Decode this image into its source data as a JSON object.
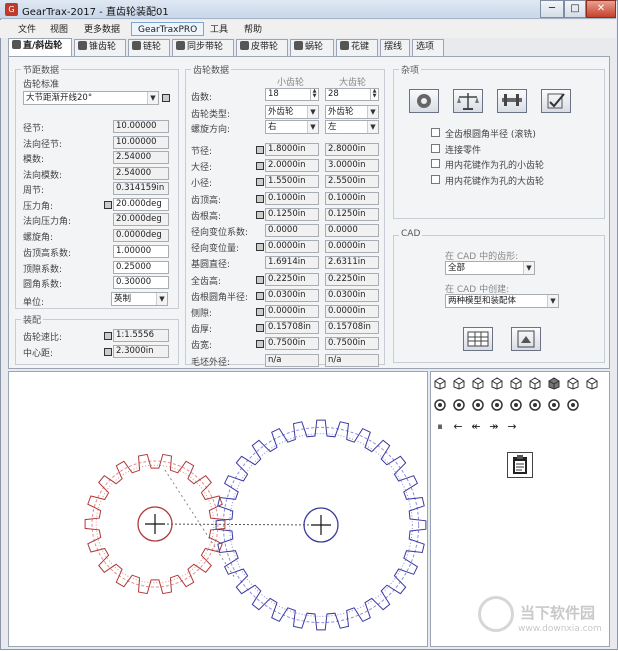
{
  "window": {
    "title": "GearTrax-2017 - 直齿轮装配01",
    "app_icon": "G",
    "min": "─",
    "max": "□",
    "close": "✕"
  },
  "menu": [
    "文件",
    "视图",
    "更多数据",
    "GearTraxPRO",
    "工具",
    "帮助"
  ],
  "tabs": [
    "直/斜齿轮",
    "锥齿轮",
    "链轮",
    "同步带轮",
    "皮带轮",
    "蜗轮",
    "花键",
    "摆线",
    "选项"
  ],
  "pitch": {
    "title": "节距数据",
    "standard_label": "齿轮标准",
    "standard_value": "大节距渐开线20°",
    "rows": [
      {
        "label": "径节:",
        "value": "10.00000"
      },
      {
        "label": "法向径节:",
        "value": "10.00000"
      },
      {
        "label": "模数:",
        "value": "2.54000"
      },
      {
        "label": "法向模数:",
        "value": "2.54000"
      },
      {
        "label": "周节:",
        "value": "0.314159in"
      },
      {
        "label": "压力角:",
        "value": "20.000deg"
      },
      {
        "label": "法向压力角:",
        "value": "20.000deg"
      },
      {
        "label": "螺旋角:",
        "value": "0.0000deg"
      }
    ],
    "rows2": [
      {
        "label": "齿顶高系数:",
        "value": "1.00000"
      },
      {
        "label": "顶隙系数:",
        "value": "0.25000"
      },
      {
        "label": "圆角系数:",
        "value": "0.30000"
      }
    ],
    "unit_label": "单位:",
    "unit_value": "英制"
  },
  "assembly": {
    "title": "装配",
    "rows": [
      {
        "label": "齿轮速比:",
        "value": "1:1.5556"
      },
      {
        "label": "中心距:",
        "value": "2.3000in"
      }
    ]
  },
  "gear": {
    "title": "齿轮数据",
    "col_small": "小齿轮",
    "col_big": "大齿轮",
    "teeth_label": "齿数:",
    "teeth_small": "18",
    "teeth_big": "28",
    "type_label": "齿轮类型:",
    "type_small": "外齿轮",
    "type_big": "外齿轮",
    "hand_label": "螺旋方向:",
    "hand_small": "右",
    "hand_big": "左",
    "rows": [
      {
        "label": "节径:",
        "small": "1.8000in",
        "big": "2.8000in"
      },
      {
        "label": "大径:",
        "small": "2.0000in",
        "big": "3.0000in"
      },
      {
        "label": "小径:",
        "small": "1.5500in",
        "big": "2.5500in"
      },
      {
        "label": "齿顶高:",
        "small": "0.1000in",
        "big": "0.1000in"
      },
      {
        "label": "齿根高:",
        "small": "0.1250in",
        "big": "0.1250in"
      },
      {
        "label": "径向变位系数:",
        "small": "0.0000",
        "big": "0.0000"
      },
      {
        "label": "径向变位量:",
        "small": "0.0000in",
        "big": "0.0000in"
      },
      {
        "label": "基圆直径:",
        "small": "1.6914in",
        "big": "2.6311in"
      },
      {
        "label": "全齿高:",
        "small": "0.2250in",
        "big": "0.2250in"
      },
      {
        "label": "齿根圆角半径:",
        "small": "0.0300in",
        "big": "0.0300in"
      },
      {
        "label": "侧隙:",
        "small": "0.0000in",
        "big": "0.0000in"
      },
      {
        "label": "齿厚:",
        "small": "0.15708in",
        "big": "0.15708in"
      },
      {
        "label": "齿宽:",
        "small": "0.7500in",
        "big": "0.7500in"
      },
      {
        "label": "毛坯外径:",
        "small": "n/a",
        "big": "n/a"
      }
    ]
  },
  "misc": {
    "title": "杂项",
    "checks": [
      "全齿根圆角半径 (滚铣)",
      "连接零件",
      "用内花键作为孔的小齿轮",
      "用内花键作为孔的大齿轮"
    ]
  },
  "cad": {
    "title": "CAD",
    "profile_label": "在 CAD 中的齿形:",
    "profile_value": "全部",
    "create_label": "在 CAD 中创建:",
    "create_value": "两种模型和装配体"
  },
  "toolbar": {
    "row3": [
      "⏸",
      "←",
      "↞",
      "↠",
      "→"
    ]
  },
  "watermark": {
    "text": "当下软件园",
    "url": "www.downxia.com"
  },
  "colors": {
    "small_gear": "#b03a3a",
    "big_gear": "#3a3a9e"
  }
}
